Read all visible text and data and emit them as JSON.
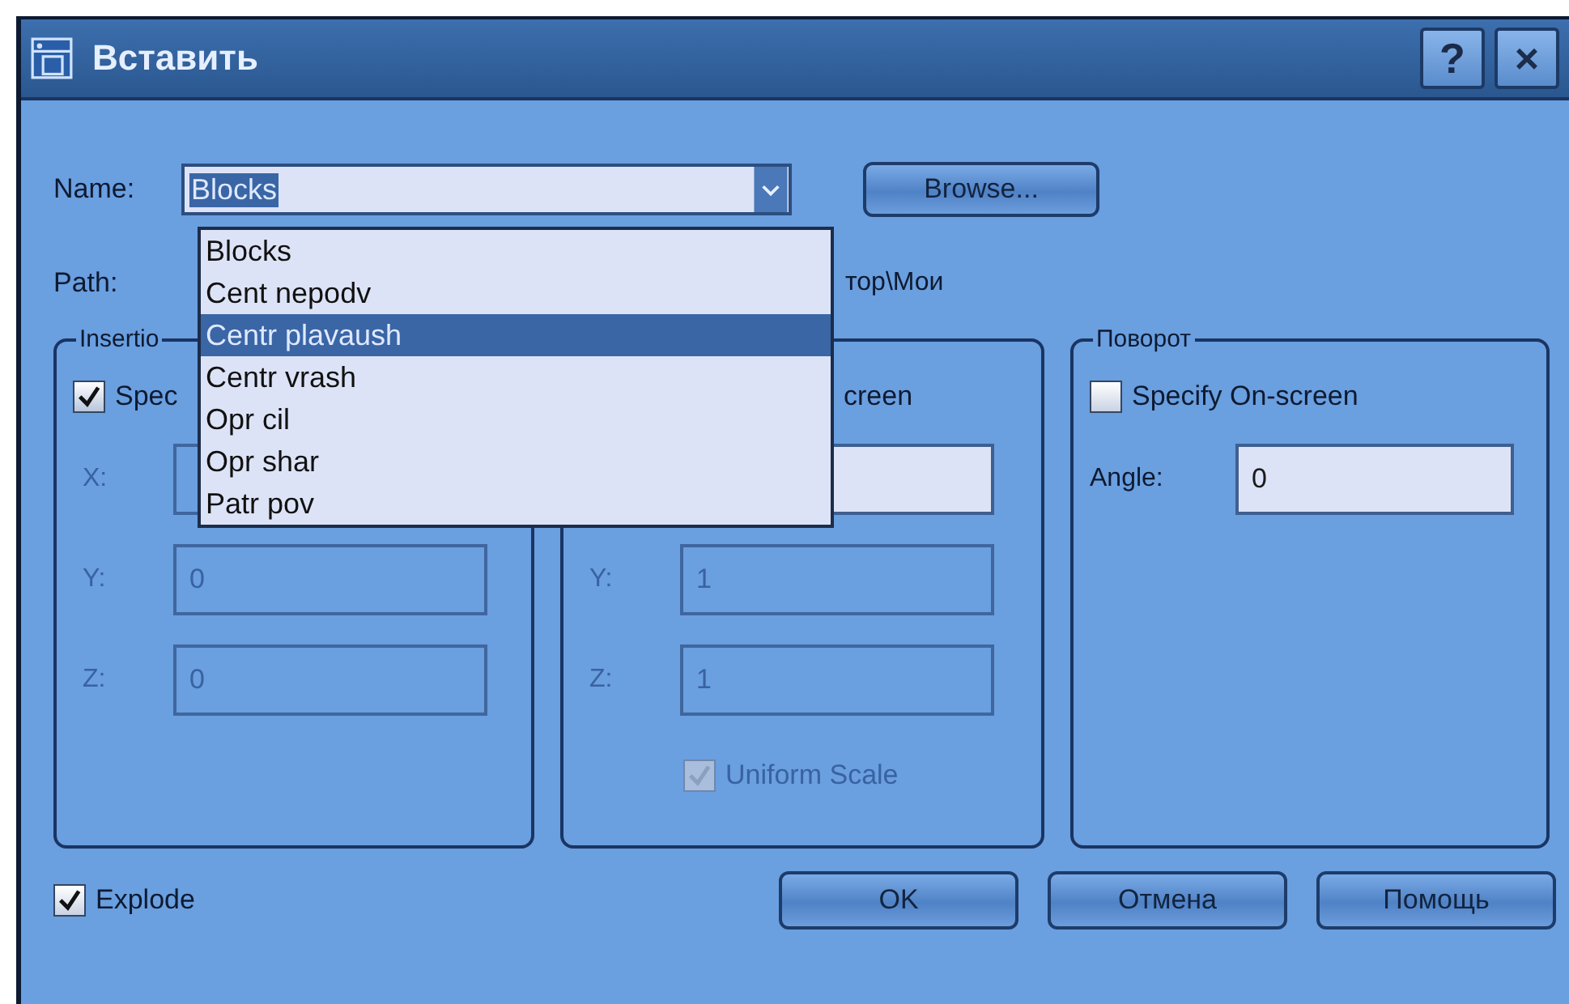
{
  "window": {
    "title": "Вставить",
    "help": "?",
    "close": "×"
  },
  "name": {
    "label": "Name:",
    "value": "Blocks",
    "button": "Browse..."
  },
  "dropdown": {
    "items": [
      {
        "label": "Blocks",
        "selected": false
      },
      {
        "label": "Cent nepodv",
        "selected": false
      },
      {
        "label": "Centr plavaush",
        "selected": true
      },
      {
        "label": "Centr vrash",
        "selected": false
      },
      {
        "label": "Opr cil",
        "selected": false
      },
      {
        "label": "Opr shar",
        "selected": false
      },
      {
        "label": "Patr pov",
        "selected": false
      }
    ]
  },
  "path": {
    "label": "Path:",
    "value": "тор\\Мои"
  },
  "groups": [
    {
      "title": "Insertio",
      "checkbox": {
        "kind": "checkbox",
        "label": "Spec",
        "checked": true
      },
      "fields": [
        {
          "label": "X:",
          "disabled": true
        },
        {
          "label": "Y:",
          "value": "0",
          "disabled": true
        },
        {
          "label": "Z:",
          "value": "0",
          "disabled": true
        }
      ]
    },
    {
      "checkbox": {
        "kind": "label_only",
        "label": "creen"
      },
      "fields": [
        {
          "disabled": false
        },
        {
          "label": "Y:",
          "value": "1",
          "disabled": true
        },
        {
          "label": "Z:",
          "value": "1",
          "disabled": true
        }
      ],
      "extra_checkbox": {
        "label": "Uniform Scale",
        "checked": true,
        "disabled": true
      }
    },
    {
      "title": "Поворот",
      "checkbox": {
        "kind": "checkbox",
        "label": "Specify On-screen",
        "checked": false
      },
      "fields": [
        {
          "label": "Angle:",
          "value": "0",
          "disabled": false
        }
      ]
    }
  ],
  "explode": {
    "label": "Explode",
    "checked": true
  },
  "buttons": [
    "OK",
    "Отмена",
    "Помощь"
  ]
}
